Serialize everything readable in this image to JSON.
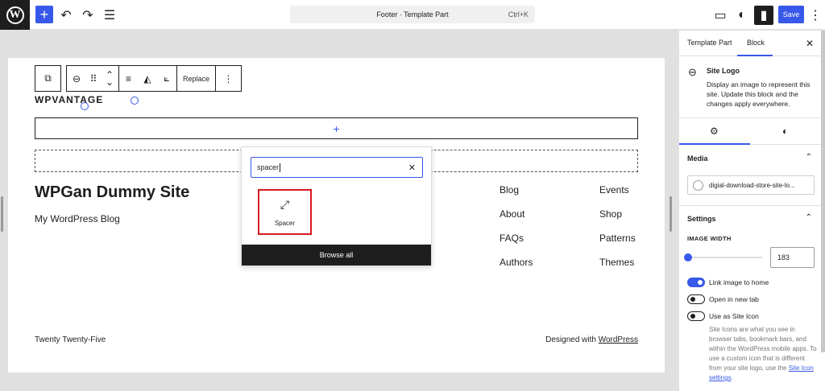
{
  "topbar": {
    "command_title": "Footer · Template Part",
    "command_shortcut": "Ctrl+K",
    "save_label": "Save",
    "icons": {
      "add": "+",
      "undo": "↶",
      "redo": "↷",
      "list_view": "☰",
      "preview": "▭",
      "style": "◐",
      "sidebar": "▮",
      "more": "⋮"
    }
  },
  "toolbar": {
    "replace_label": "Replace",
    "icons": {
      "transform": "⧉",
      "site_logo": "⊖",
      "drag": "⠿",
      "move_up": "⌃",
      "move_down": "⌄",
      "align": "≡",
      "duotone": "◭",
      "crop": "⟀",
      "more": "⋮"
    }
  },
  "canvas": {
    "logo_text": "WPVANTAGE",
    "appender_icon": "+",
    "site_title": "WPGan Dummy Site",
    "tagline": "My WordPress Blog",
    "nav": [
      "Blog",
      "About",
      "FAQs",
      "Authors",
      "Events",
      "Shop",
      "Patterns",
      "Themes"
    ],
    "footer_left": "Twenty Twenty-Five",
    "footer_right_prefix": "Designed with ",
    "footer_right_link": "WordPress"
  },
  "inserter": {
    "search_value": "spacer",
    "clear_icon": "✕",
    "result_icon": "⤢",
    "result_label": "Spacer",
    "browse_label": "Browse all"
  },
  "sidebar": {
    "tab_template_part": "Template Part",
    "tab_block": "Block",
    "close_icon": "✕",
    "block_icon": "⊖",
    "block_title": "Site Logo",
    "block_description": "Display an image to represent this site. Update this block and the changes apply everywhere.",
    "settings_tab_icon": "⚙",
    "styles_tab_icon": "◐",
    "media_heading": "Media",
    "media_file": "digial-download-store-site-lo...",
    "settings_heading": "Settings",
    "chevron_icon": "⌃",
    "image_width_label": "IMAGE WIDTH",
    "image_width_value": "183",
    "link_home_label": "Link image to home",
    "new_tab_label": "Open in new tab",
    "site_icon_label": "Use as Site Icon",
    "help_text": "Site Icons are what you see in browser tabs, bookmark bars, and within the WordPress mobile apps. To use a custom icon that is different from your site logo, use the ",
    "help_link": "Site Icon settings",
    "help_end": ".",
    "link_home_on": true,
    "new_tab_on": false,
    "site_icon_on": false
  }
}
